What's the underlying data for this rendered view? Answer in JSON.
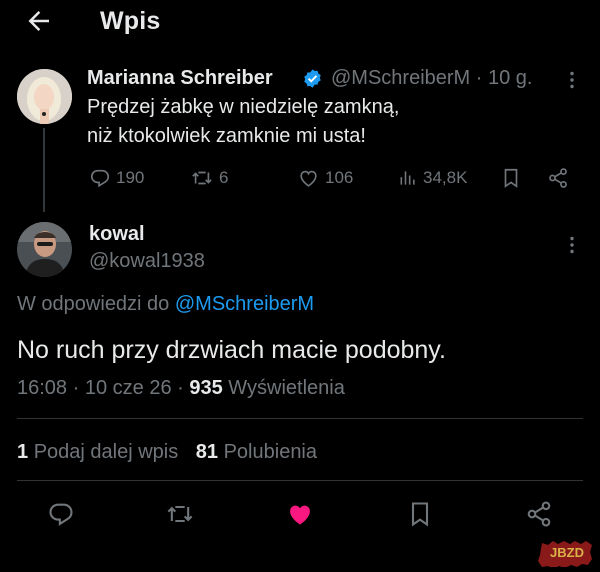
{
  "header": {
    "title": "Wpis"
  },
  "parent_tweet": {
    "author_name": "Marianna Schreiber",
    "handle_time": "@MSchreiberM · 10 g.",
    "text_line1": "Prędzej żabkę w niedzielę zamkną,",
    "text_line2": "niż ktokolwiek zamknie mi usta!",
    "replies": "190",
    "reposts": "6",
    "likes": "106",
    "views": "34,8K"
  },
  "main_tweet": {
    "author_name": "kowal",
    "handle": "@kowal1938",
    "reply_to_prefix": "W odpowiedzi do",
    "reply_to_handle": "@MSchreiberM",
    "text": "No ruch przy drzwiach macie podobny.",
    "time": "16:08",
    "date": "10 cze 26",
    "views_count": "935",
    "views_label": "Wyświetlenia",
    "reposts_count": "1",
    "reposts_label": "Podaj dalej wpis",
    "likes_count": "81",
    "likes_label": "Polubienia"
  },
  "colors": {
    "accent": "#1d9bf0",
    "like": "#f91880",
    "muted": "#71767b",
    "text": "#e7e9ea",
    "background": "#000000"
  },
  "icons": [
    "back-arrow-icon",
    "verified-badge-icon",
    "more-icon",
    "reply-icon",
    "repost-icon",
    "like-icon",
    "views-icon",
    "bookmark-icon",
    "share-icon"
  ],
  "watermark": "JBZD"
}
